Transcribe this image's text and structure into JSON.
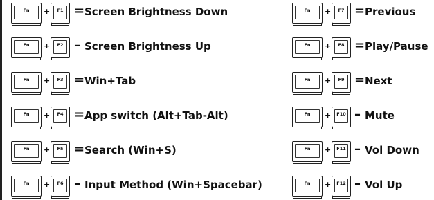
{
  "fn_label": "Fn",
  "left": [
    {
      "key": "F1",
      "sep": "=",
      "desc": "Screen Brightness Down"
    },
    {
      "key": "F2",
      "sep": "–",
      "desc": "Screen Brightness Up"
    },
    {
      "key": "F3",
      "sep": "=",
      "desc": "Win+Tab"
    },
    {
      "key": "F4",
      "sep": "=",
      "desc": "App switch (Alt+Tab-Alt)"
    },
    {
      "key": "F5",
      "sep": "=",
      "desc": "Search (Win+S)"
    },
    {
      "key": "F6",
      "sep": "–",
      "desc": "Input Method (Win+Spacebar)"
    }
  ],
  "right": [
    {
      "key": "F7",
      "sep": "=",
      "desc": "Previous"
    },
    {
      "key": "F8",
      "sep": "=",
      "desc": "Play/Pause"
    },
    {
      "key": "F9",
      "sep": "=",
      "desc": "Next"
    },
    {
      "key": "F10",
      "sep": "–",
      "desc": "Mute"
    },
    {
      "key": "F11",
      "sep": "–",
      "desc": "Vol Down"
    },
    {
      "key": "F12",
      "sep": "–",
      "desc": "Vol Up"
    }
  ]
}
